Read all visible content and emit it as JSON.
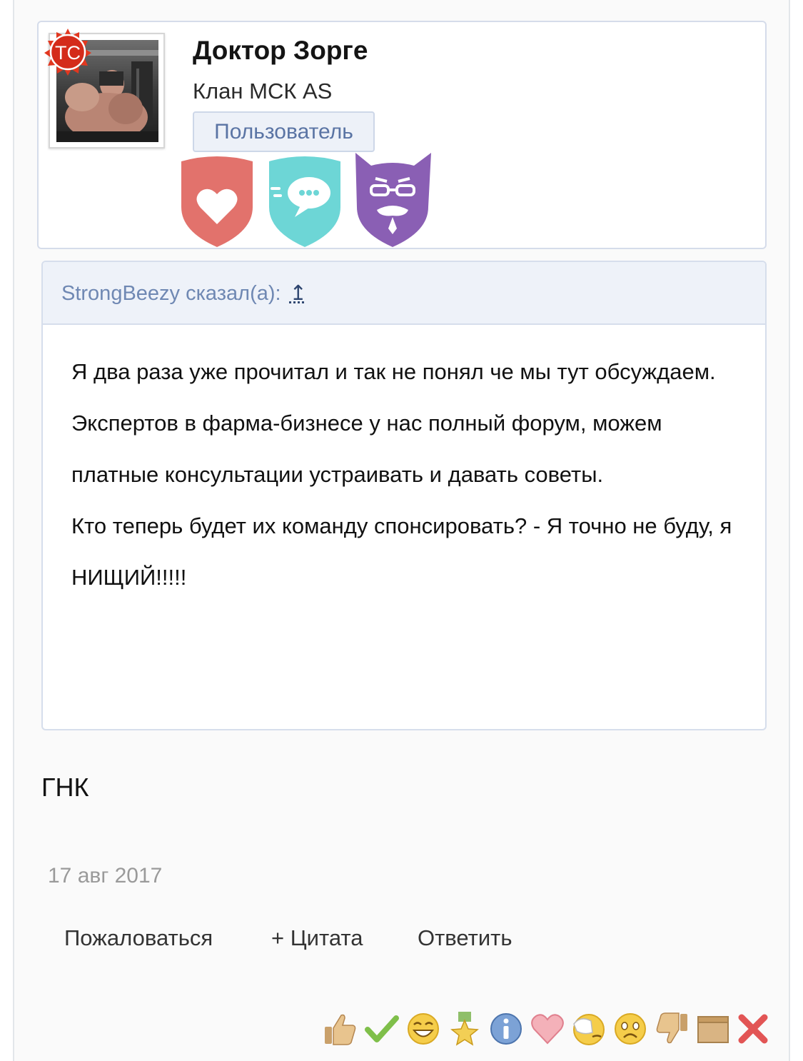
{
  "user": {
    "name": "Доктор Зорге",
    "clan": "Клан МСК AS",
    "role": "Пользователь",
    "starter_badge": "TC",
    "awards": [
      "heart-award-icon",
      "chat-award-icon",
      "mask-award-icon"
    ]
  },
  "quote": {
    "author_line": "StrongBeezy сказал(а):",
    "jump_icon": "↥",
    "lines": [
      "Я два раза уже прочитал и так не понял че мы тут обсуждаем.",
      "Экспертов в фарма-бизнесе у нас полный форум, можем платные консультации устраивать и давать советы.",
      "Кто теперь будет их команду спонсировать? - Я точно не буду, я НИЩИЙ!!!!!"
    ]
  },
  "post": {
    "message": "ГНК",
    "date": "17 авг 2017"
  },
  "actions": {
    "report": "Пожаловаться",
    "quote": "+ Цитата",
    "reply": "Ответить"
  },
  "ratings": [
    "thumbs-up-icon",
    "check-icon",
    "laugh-icon",
    "star-medal-icon",
    "info-icon",
    "heart-icon",
    "facepalm-icon",
    "sad-icon",
    "thumbs-down-icon",
    "box-icon",
    "cross-icon"
  ],
  "colors": {
    "award_heart": "#e2726c",
    "award_chat": "#6dd6d6",
    "award_mask": "#8a5fb4",
    "role_text": "#5a74a4",
    "quote_header_text": "#6f88b3"
  }
}
